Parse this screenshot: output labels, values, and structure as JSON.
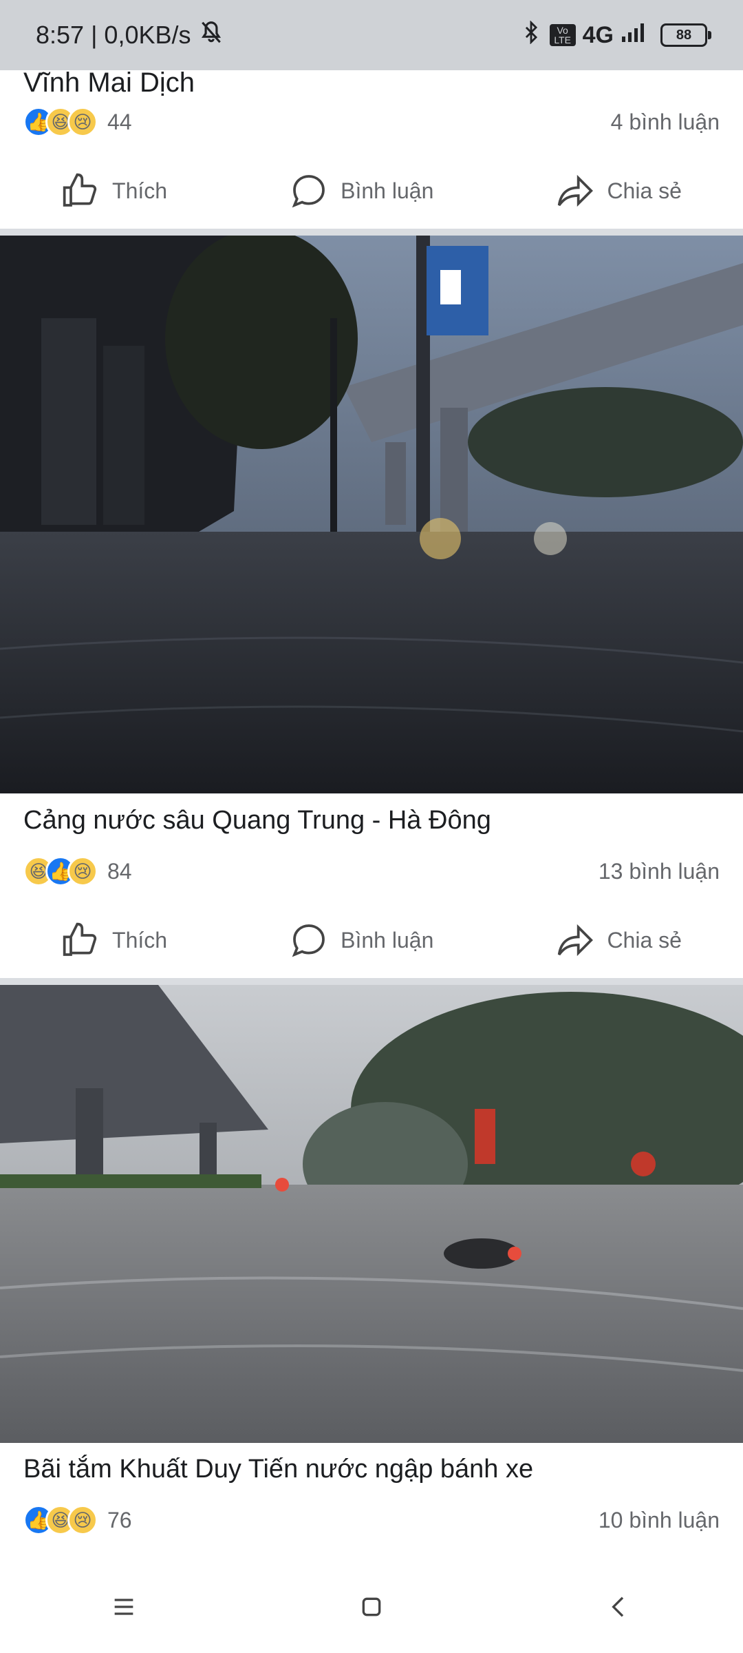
{
  "status": {
    "time_speed": "8:57 | 0,0KB/s",
    "network": "4G",
    "volte": "Vo LTE",
    "battery": "88"
  },
  "post0": {
    "title": "Vĩnh Mai Dịch",
    "reaction_count": "44",
    "comments": "4 bình luận"
  },
  "actions": {
    "like": "Thích",
    "comment": "Bình luận",
    "share": "Chia sẻ"
  },
  "post1": {
    "title": "Cảng nước sâu Quang Trung - Hà Đông",
    "reaction_count": "84",
    "comments": "13 bình luận"
  },
  "post2": {
    "title": "Bãi tắm Khuất Duy Tiến nước ngập bánh xe",
    "reaction_count": "76",
    "comments": "10 bình luận"
  },
  "icons": [
    "bluetooth-icon",
    "signal-icon",
    "battery-icon",
    "mute-icon",
    "like-icon",
    "comment-icon",
    "share-icon",
    "menu-icon",
    "home-icon",
    "back-icon"
  ]
}
